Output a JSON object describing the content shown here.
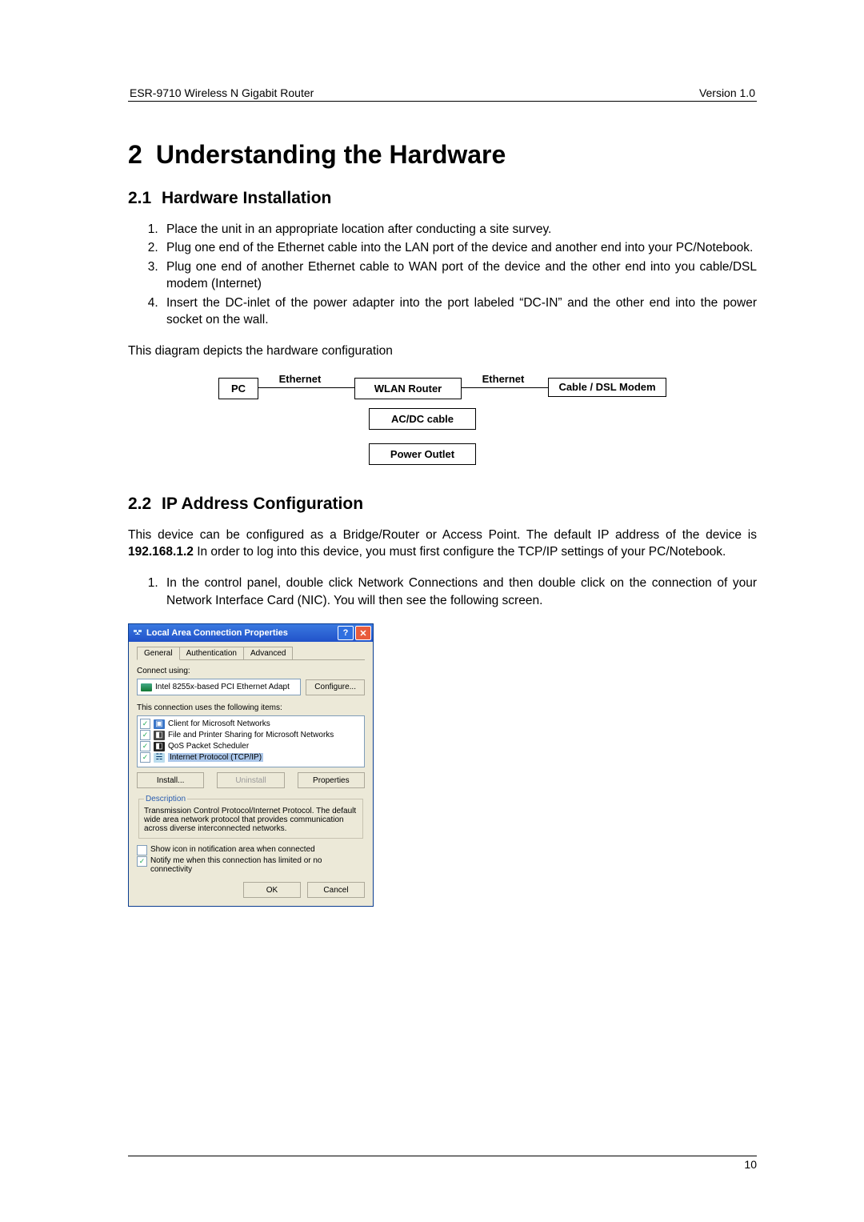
{
  "header": {
    "left": "ESR-9710 Wireless N Gigabit Router",
    "right": "Version 1.0"
  },
  "chapter": {
    "num": "2",
    "title": "Understanding the Hardware"
  },
  "section1": {
    "num": "2.1",
    "title": "Hardware Installation",
    "steps": [
      "Place the unit in an appropriate location after conducting a site survey.",
      "Plug one end of the Ethernet cable into the LAN port of the device and another end into your PC/Notebook.",
      "Plug one end of another Ethernet cable to WAN port of the device and the other end into you cable/DSL modem (Internet)",
      "Insert the DC-inlet of the power adapter into the port labeled “DC-IN” and the other end into the power socket on the wall."
    ],
    "after": "This diagram depicts the hardware configuration"
  },
  "diagram": {
    "pc": "PC",
    "eth1": "Ethernet",
    "wlan": "WLAN Router",
    "eth2": "Ethernet",
    "modem": "Cable / DSL Modem",
    "acdc": "AC/DC cable",
    "outlet": "Power Outlet"
  },
  "section2": {
    "num": "2.2",
    "title": "IP Address Configuration",
    "para_pre": "This device can be configured as a Bridge/Router or Access Point.  The default IP address of the device is ",
    "ip": "192.168.1.2",
    "para_post": " In order to log into this device, you must first configure the TCP/IP settings of your PC/Notebook.",
    "step1": "In the control panel, double click Network Connections and then double click on the connection of your Network Interface Card (NIC). You will then see the following screen."
  },
  "dialog": {
    "title": "Local Area Connection Properties",
    "tabs": [
      "General",
      "Authentication",
      "Advanced"
    ],
    "connect_using": "Connect using:",
    "adapter": "Intel 8255x-based PCI Ethernet Adapt",
    "configure": "Configure...",
    "items_label": "This connection uses the following items:",
    "items": [
      "Client for Microsoft Networks",
      "File and Printer Sharing for Microsoft Networks",
      "QoS Packet Scheduler",
      "Internet Protocol (TCP/IP)"
    ],
    "install": "Install...",
    "uninstall": "Uninstall",
    "properties": "Properties",
    "description_title": "Description",
    "description": "Transmission Control Protocol/Internet Protocol. The default wide area network protocol that provides communication across diverse interconnected networks.",
    "show_icon": "Show icon in notification area when connected",
    "notify": "Notify me when this connection has limited or no connectivity",
    "ok": "OK",
    "cancel": "Cancel"
  },
  "page_number": "10"
}
